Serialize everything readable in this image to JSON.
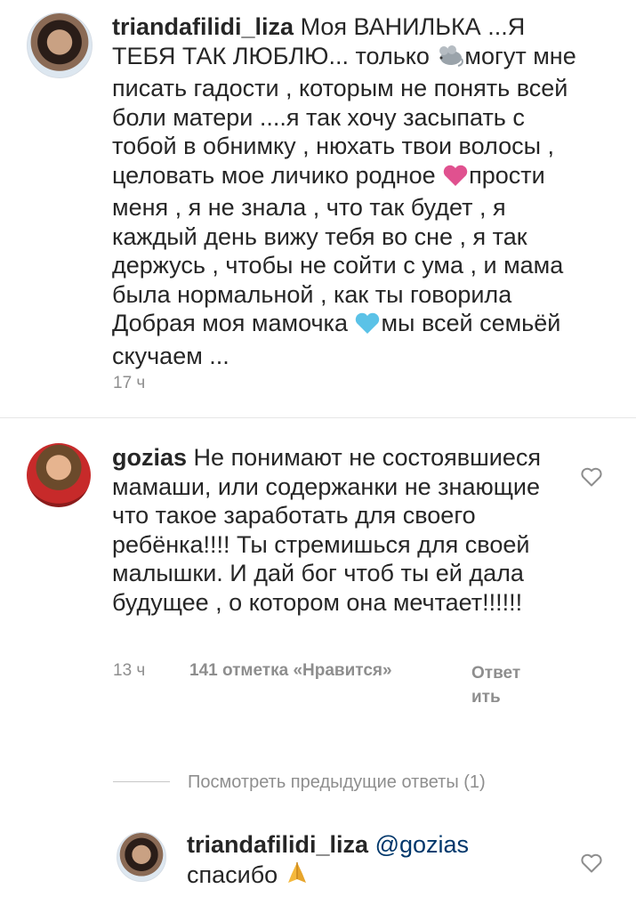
{
  "comments": [
    {
      "username": "triandafilidi_liza",
      "text_parts": [
        "Моя ВАНИЛЬКА ...Я ТЕБЯ ТАК ЛЮБЛЮ... только ",
        "могут мне писать гадости , которым не понять всей боли матери ....я так хочу засыпать с тобой в обнимку , нюхать твои волосы , целовать мое личико родное ",
        "прости меня , я не знала , что так будет , я каждый день вижу тебя во сне , я так держусь , чтобы не сойти с ума , и мама была нормальной , как ты говорила Добрая моя мамочка ",
        "мы всей семьёй скучаем ..."
      ],
      "emojis": [
        "mouse-emoji",
        "pink-heart-emoji",
        "blue-heart-emoji"
      ],
      "time": "17 ч"
    },
    {
      "username": "gozias",
      "text": "Не понимают не состоявшиеся мамаши, или содержанки не знающие что такое заработать для своего ребёнка!!!! Ты стремишься для своей малышки. И дай бог чтоб ты ей дала будущее , о котором она мечтает!!!!!!",
      "time": "13 ч",
      "likes": "141 отметка «Нравится»",
      "reply": "Ответить",
      "view_replies": "Посмотреть предыдущие ответы (1)"
    },
    {
      "username": "triandafilidi_liza",
      "mention": "@gozias",
      "text": "спасибо",
      "emoji": "praying-hands-emoji"
    }
  ],
  "colors": {
    "text": "#262626",
    "secondary": "#8e8e8e",
    "mention": "#00376b",
    "pink_heart": "#e0518f",
    "blue_heart": "#5bc2e7"
  }
}
